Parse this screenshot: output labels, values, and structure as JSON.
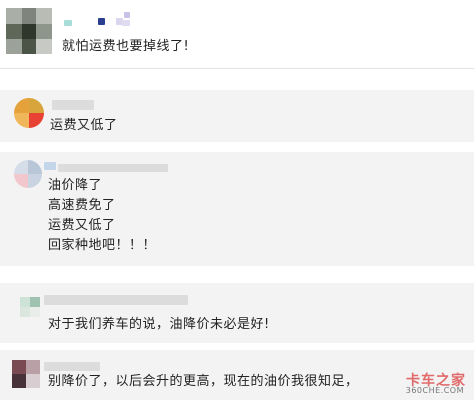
{
  "post": {
    "text": "就怕运费也要掉线了!"
  },
  "comments": [
    {
      "lines": [
        "运费又低了"
      ]
    },
    {
      "lines": [
        "油价降了",
        "高速费免了",
        "运费又低了",
        "回家种地吧！！！"
      ]
    },
    {
      "lines": [
        "对于我们养车的说，油降价未必是好!"
      ]
    },
    {
      "lines": [
        "别降价了，以后会升的更高，现在的油价我很知足，"
      ]
    }
  ],
  "watermark": {
    "main": "卡车之家",
    "sub": "360CHE.COM"
  },
  "colors": {
    "card_background": "#f3f3f3",
    "text": "#222222",
    "watermark": "#e06a6a"
  }
}
